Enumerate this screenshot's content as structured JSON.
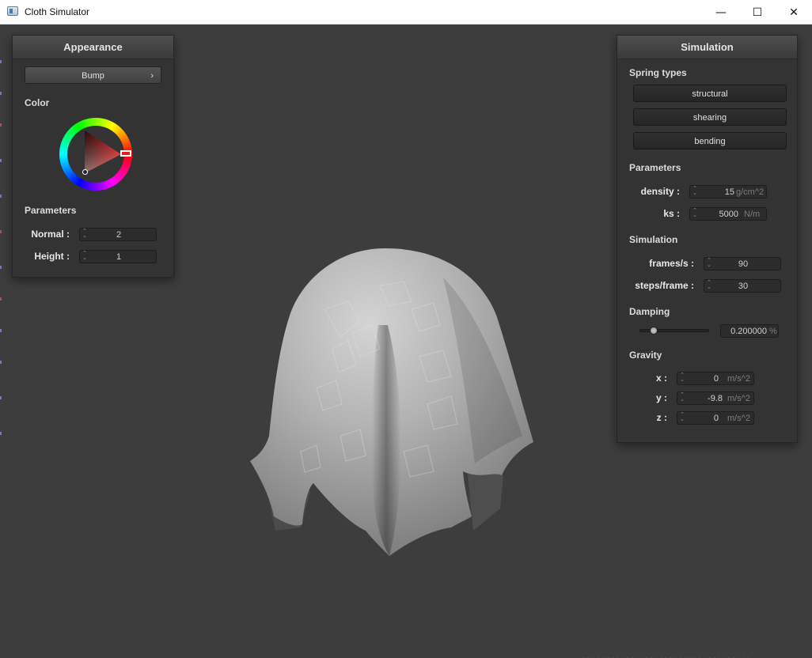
{
  "window": {
    "title": "Cloth Simulator",
    "minimize": "—",
    "maximize": "☐",
    "close": "✕",
    "app_icon": "window-app-icon"
  },
  "appearance": {
    "title": "Appearance",
    "shader_button": "Bump",
    "shader_chevron": "›",
    "color_label": "Color",
    "selected_color": "#e02020",
    "parameters_label": "Parameters",
    "fields": [
      {
        "label": "Normal :",
        "value": "2"
      },
      {
        "label": "Height :",
        "value": "1"
      }
    ]
  },
  "simulation": {
    "title": "Simulation",
    "spring_types_label": "Spring types",
    "spring_buttons": [
      "structural",
      "shearing",
      "bending"
    ],
    "parameters_label": "Parameters",
    "density": {
      "label": "density :",
      "value": "15",
      "unit": "g/cm^2"
    },
    "ks": {
      "label": "ks :",
      "value": "5000",
      "unit": "N/m"
    },
    "simulation_label": "Simulation",
    "frames": {
      "label": "frames/s :",
      "value": "90"
    },
    "steps": {
      "label": "steps/frame :",
      "value": "30"
    },
    "damping_label": "Damping",
    "damping": {
      "value": "0.200000",
      "unit": "%",
      "fraction": 0.2
    },
    "gravity_label": "Gravity",
    "gravity": [
      {
        "label": "x :",
        "value": "0",
        "unit": "m/s^2"
      },
      {
        "label": "y :",
        "value": "-9.8",
        "unit": "m/s^2"
      },
      {
        "label": "z :",
        "value": "0",
        "unit": "m/s^2"
      }
    ]
  },
  "colors": {
    "viewport_bg": "#3d3d3d",
    "panel_bg": "#333333",
    "cloth": "#aaaaaa"
  },
  "icons": {
    "spinner": "spinner-icon",
    "chevron": "chevron-right-icon"
  }
}
